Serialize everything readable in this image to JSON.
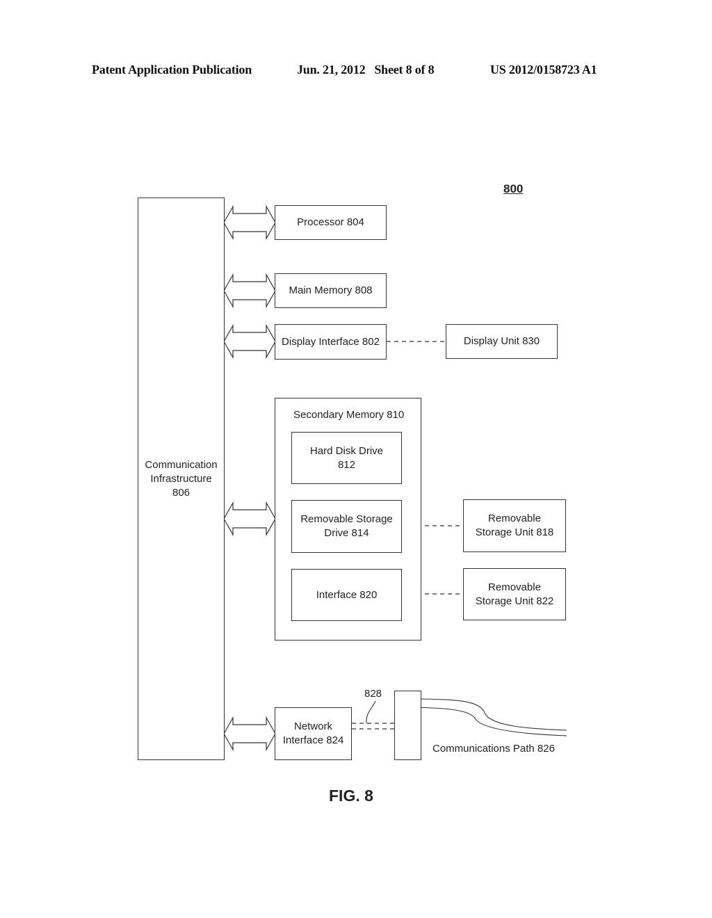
{
  "header": {
    "publication": "Patent Application Publication",
    "date_sheet": "Jun. 21, 2012   Sheet 8 of 8",
    "number": "US 2012/0158723 A1"
  },
  "figure": {
    "ref_number": "800",
    "caption": "FIG. 8"
  },
  "blocks": {
    "comm_infra": "Communication\nInfrastructure\n806",
    "processor": "Processor 804",
    "main_memory": "Main Memory 808",
    "display_interface": "Display Interface 802",
    "display_unit": "Display Unit 830",
    "secondary_memory": "Secondary Memory 810",
    "hard_disk": "Hard Disk Drive\n812",
    "removable_drive": "Removable Storage\nDrive 814",
    "interface": "Interface 820",
    "removable_unit_818": "Removable\nStorage Unit 818",
    "removable_unit_822": "Removable\nStorage Unit 822",
    "network_interface": "Network\nInterface 824",
    "channel_label": "828",
    "comm_path": "Communications Path 826"
  }
}
